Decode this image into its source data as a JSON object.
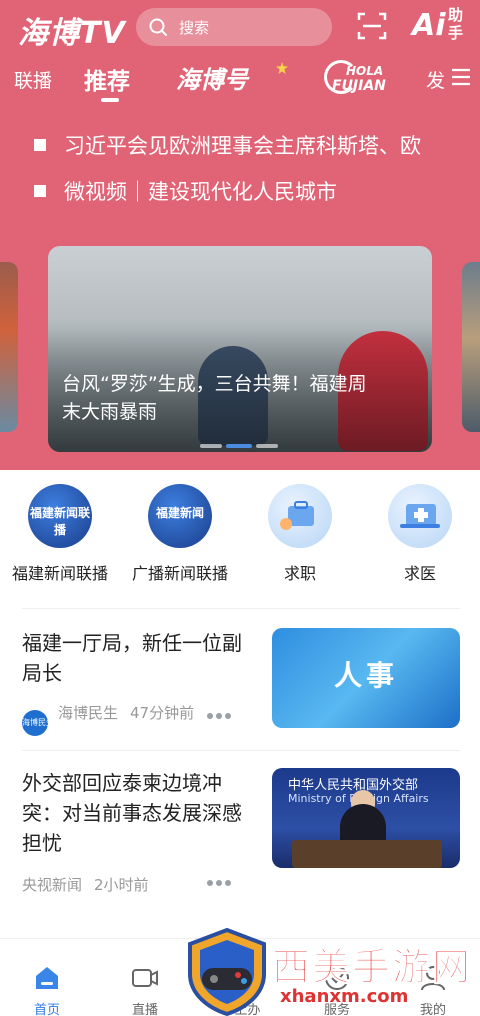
{
  "header": {
    "logo": "海博TV",
    "search_placeholder": "搜索",
    "ai_label": "Ai",
    "ai_helper": "助手"
  },
  "tabs": {
    "lianbo": "联播",
    "tuijian": "推荐",
    "haibohao": "海博号",
    "hola_top": "HOLA",
    "hola_bottom": "FUJIAN",
    "fa": "发"
  },
  "headlines": [
    "习近平会见欧洲理事会主席科斯塔、欧",
    "微视频｜建设现代化人民城市"
  ],
  "carousel": {
    "title": "台风“罗莎”生成，三台共舞！福建周末大雨暴雨",
    "active_index": 1,
    "count": 3
  },
  "quick_entries": [
    {
      "label": "福建新闻联播",
      "icon_text": "福建新闻联播"
    },
    {
      "label": "广播新闻联播",
      "icon_text": "福建新闻"
    },
    {
      "label": "求职",
      "icon_text": ""
    },
    {
      "label": "求医",
      "icon_text": ""
    }
  ],
  "news": [
    {
      "title": "福建一厅局，新任一位副局长",
      "source": "海博民生",
      "time": "47分钟前",
      "source_icon_text": "海博民生",
      "thumb_text": "人事"
    },
    {
      "title": "外交部回应泰柬边境冲突：对当前事态发展深感担忧",
      "source": "央视新闻",
      "time": "2小时前",
      "thumb_title": "中华人民共和国外交部",
      "thumb_sub": "Ministry of Foreign Affairs"
    }
  ],
  "bottom_nav": [
    {
      "label": "首页",
      "icon": "home-icon",
      "active": true
    },
    {
      "label": "直播",
      "icon": "video-icon",
      "active": false
    },
    {
      "label": "掌上办",
      "icon": "grid-icon",
      "active": false
    },
    {
      "label": "服务",
      "icon": "service-icon",
      "active": false
    },
    {
      "label": "我的",
      "icon": "user-icon",
      "active": false
    }
  ],
  "watermark": {
    "title": "西美手游网",
    "url": "xhanxm.com"
  },
  "colors": {
    "hero_bg": "#e06476",
    "accent": "#2f7be0"
  }
}
